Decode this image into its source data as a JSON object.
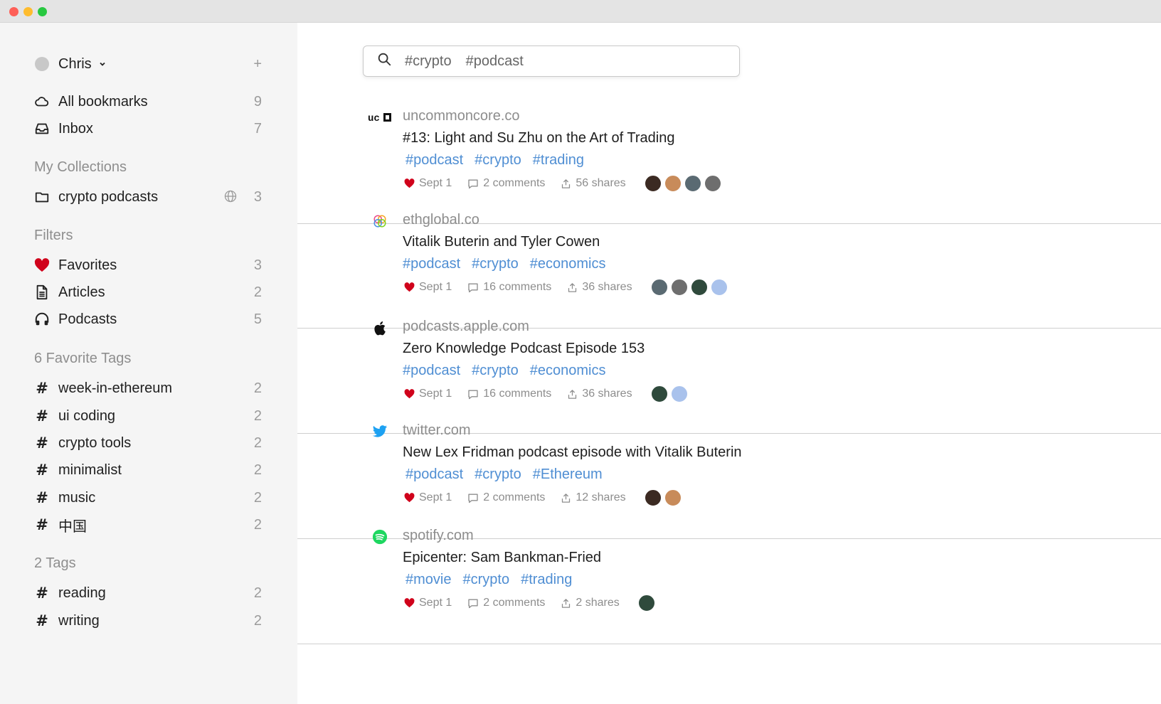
{
  "sidebar": {
    "user": {
      "name": "Chris",
      "add_label": "+"
    },
    "nav": [
      {
        "label": "All bookmarks",
        "count": "9",
        "icon": "cloud-icon"
      },
      {
        "label": "Inbox",
        "count": "7",
        "icon": "inbox-icon"
      }
    ],
    "collections": {
      "heading": "My Collections",
      "items": [
        {
          "label": "crypto podcasts",
          "count": "3",
          "icon": "folder-icon"
        }
      ]
    },
    "filters": {
      "heading": "Filters",
      "items": [
        {
          "label": "Favorites",
          "count": "3",
          "icon": "heart-icon"
        },
        {
          "label": "Articles",
          "count": "2",
          "icon": "document-icon"
        },
        {
          "label": "Podcasts",
          "count": "5",
          "icon": "headphones-icon"
        }
      ]
    },
    "favorite_tags": {
      "heading": "6 Favorite Tags",
      "items": [
        {
          "label": "week-in-ethereum",
          "count": "2"
        },
        {
          "label": "ui coding",
          "count": "2"
        },
        {
          "label": "crypto tools",
          "count": "2"
        },
        {
          "label": "minimalist",
          "count": "2"
        },
        {
          "label": "music",
          "count": "2"
        },
        {
          "label": "中国",
          "count": "2"
        }
      ]
    },
    "tags": {
      "heading": "2 Tags",
      "items": [
        {
          "label": "reading",
          "count": "2"
        },
        {
          "label": "writing",
          "count": "2"
        }
      ]
    },
    "hash_symbol": "#"
  },
  "search": {
    "tags": [
      "#crypto",
      "#podcast"
    ]
  },
  "bookmarks": [
    {
      "domain": "uncommoncore.co",
      "title": "#13: Light and Su Zhu on the Art of Trading",
      "tags": [
        "#podcast",
        "#crypto",
        "#trading"
      ],
      "date": "Sept 1",
      "comments": "2 comments",
      "shares": "56 shares",
      "favicon": "ucc-logo"
    },
    {
      "domain": "ethglobal.co",
      "title": "Vitalik Buterin and Tyler Cowen",
      "tags": [
        "#podcast",
        "#crypto",
        "#economics"
      ],
      "date": "Sept 1",
      "comments": "16 comments",
      "shares": "36 shares",
      "favicon": "ethglobal-logo"
    },
    {
      "domain": "podcasts.apple.com",
      "title": "Zero Knowledge Podcast Episode 153",
      "tags": [
        "#podcast",
        "#crypto",
        "#economics"
      ],
      "date": "Sept 1",
      "comments": "16 comments",
      "shares": "36 shares",
      "favicon": "apple-logo"
    },
    {
      "domain": "twitter.com",
      "title": "New Lex Fridman podcast episode with Vitalik Buterin",
      "tags": [
        "#podcast",
        "#crypto",
        "#Ethereum"
      ],
      "date": "Sept 1",
      "comments": "2 comments",
      "shares": "12 shares",
      "favicon": "twitter-logo"
    },
    {
      "domain": "spotify.com",
      "title": "Epicenter: Sam Bankman-Fried",
      "tags": [
        "#movie",
        "#crypto",
        "#trading"
      ],
      "date": "Sept 1",
      "comments": "2 comments",
      "shares": "2 shares",
      "favicon": "spotify-logo"
    }
  ],
  "colors": {
    "accent_tag": "#4f8ed3",
    "heart": "#d0021b",
    "sidebar_bg": "#f5f5f5"
  }
}
